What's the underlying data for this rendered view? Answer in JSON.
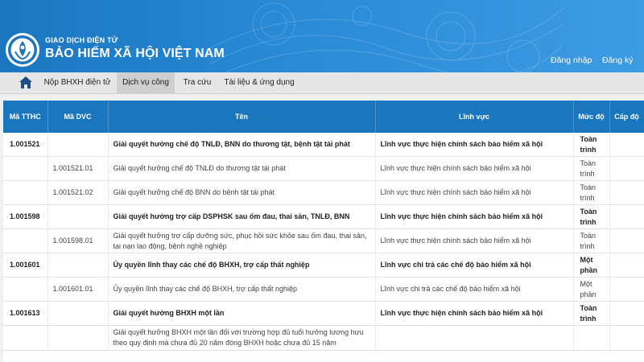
{
  "header": {
    "brand_sub": "GIAO DỊCH ĐIỆN TỬ",
    "brand_main": "BẢO HIỂM XÃ HỘI VIỆT NAM",
    "login": "Đăng nhập",
    "register": "Đăng ký",
    "logo_text": "BẢO HIỂM XÃ HỘI VIỆT NAM"
  },
  "nav": {
    "items": [
      {
        "label": "Nộp BHXH điện tử"
      },
      {
        "label": "Dịch vụ công"
      },
      {
        "label": "Tra cứu"
      },
      {
        "label": "Tài liệu & ứng dụng"
      }
    ],
    "active_index": 1
  },
  "table": {
    "headers": [
      "Mã TTHC",
      "Mã DVC",
      "Tên",
      "Lĩnh vực",
      "Mức độ",
      "Cấp độ"
    ],
    "rows": [
      {
        "ma_tthc": "1.001521",
        "ma_dvc": "",
        "ten": "Giải quyết hưởng chế độ TNLĐ, BNN do thương tật, bệnh tật tái phát",
        "linh_vuc": "Lĩnh vực thực hiện chính sách bảo hiểm xã hội",
        "muc_do": "Toàn trình",
        "cap_do": ""
      },
      {
        "ma_tthc": "",
        "ma_dvc": "1.001521.01",
        "ten": "Giải quyết hưởng chế độ TNLĐ do thương tật tái phát",
        "linh_vuc": "Lĩnh vực thực hiện chính sách bảo hiểm xã hội",
        "muc_do": "Toàn trình",
        "cap_do": ""
      },
      {
        "ma_tthc": "",
        "ma_dvc": "1.001521.02",
        "ten": "Giải quyết hưởng chế độ BNN do bệnh tật tái phát",
        "linh_vuc": "Lĩnh vực thực hiện chính sách bảo hiểm xã hội",
        "muc_do": "Toàn trình",
        "cap_do": ""
      },
      {
        "ma_tthc": "1.001598",
        "ma_dvc": "",
        "ten": "Giải quyết hưởng trợ cấp DSPHSK sau ốm đau, thai sản, TNLĐ, BNN",
        "linh_vuc": "Lĩnh vực thực hiện chính sách bảo hiểm xã hội",
        "muc_do": "Toàn trình",
        "cap_do": ""
      },
      {
        "ma_tthc": "",
        "ma_dvc": "1.001598.01",
        "ten": "Giải quyết hưởng trợ cấp dưỡng sức, phục hồi sức khỏe sau ốm đau, thai sản, tai nạn lao động, bệnh nghề nghiệp",
        "linh_vuc": "Lĩnh vực thực hiện chính sách bảo hiểm xã hội",
        "muc_do": "Toàn trình",
        "cap_do": ""
      },
      {
        "ma_tthc": "1.001601",
        "ma_dvc": "",
        "ten": "Ủy quyền lĩnh thay các chế độ BHXH, trợ cấp thất nghiệp",
        "linh_vuc": "Lĩnh vực chi trả các chế độ bảo hiểm xã hội",
        "muc_do": "Một phần",
        "cap_do": ""
      },
      {
        "ma_tthc": "",
        "ma_dvc": "1.001601.01",
        "ten": "Ủy quyền lĩnh thay các chế độ BHXH, trợ cấp thất nghiệp",
        "linh_vuc": "Lĩnh vực chi trả các chế độ bảo hiểm xã hội",
        "muc_do": "Một phần",
        "cap_do": ""
      },
      {
        "ma_tthc": "1.001613",
        "ma_dvc": "",
        "ten": "Giải quyết hưởng BHXH một lần",
        "linh_vuc": "Lĩnh vực thực hiện chính sách bảo hiểm xã hội",
        "muc_do": "Toàn trình",
        "cap_do": ""
      },
      {
        "ma_tthc": "",
        "ma_dvc": "",
        "ten": "Giải quyết hưởng BHXH một lần đối với trường hợp đủ tuổi hưởng lương hưu theo quy định mà chưa đủ 20 năm đóng BHXH hoặc chưa đủ 15 năm",
        "linh_vuc": "",
        "muc_do": "",
        "cap_do": ""
      }
    ]
  }
}
